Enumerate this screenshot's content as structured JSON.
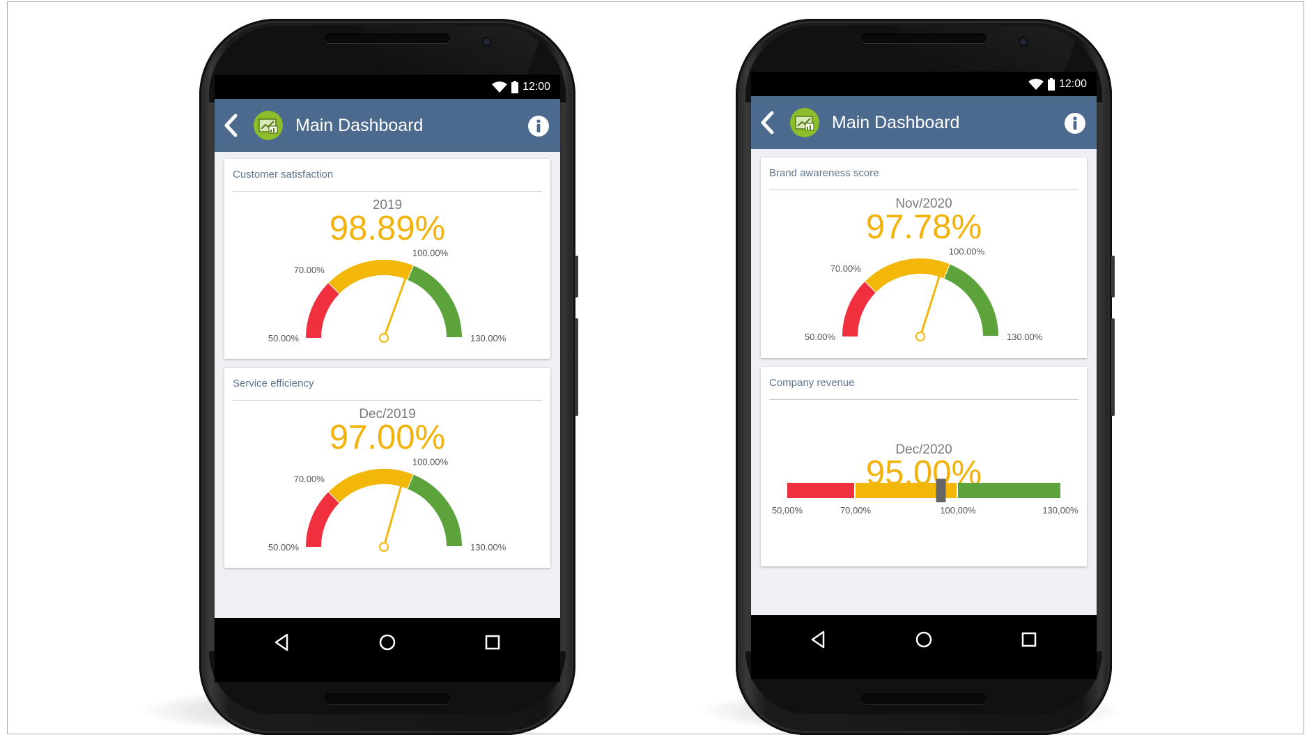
{
  "status_bar": {
    "time": "12:00"
  },
  "app_bar": {
    "title": "Main Dashboard"
  },
  "phones": [
    {
      "cards": [
        {
          "title": "Customer satisfaction",
          "period": "2019",
          "value": "98.89%",
          "widget": "gauge",
          "value_number": 98.89,
          "ticks": {
            "min": "50.00%",
            "low": "70.00%",
            "high": "100.00%",
            "max": "130.00%"
          }
        },
        {
          "title": "Service efficiency",
          "period": "Dec/2019",
          "value": "97.00%",
          "widget": "gauge",
          "value_number": 97.0,
          "ticks": {
            "min": "50.00%",
            "low": "70.00%",
            "high": "100.00%",
            "max": "130.00%"
          }
        }
      ]
    },
    {
      "cards": [
        {
          "title": "Brand awareness score",
          "period": "Nov/2020",
          "value": "97.78%",
          "widget": "gauge",
          "value_number": 97.78,
          "ticks": {
            "min": "50.00%",
            "low": "70.00%",
            "high": "100.00%",
            "max": "130.00%"
          }
        },
        {
          "title": "Company revenue",
          "period": "Dec/2020",
          "value": "95.00%",
          "widget": "bullet",
          "value_number": 95.0,
          "ticks": {
            "min": "50,00%",
            "low": "70,00%",
            "high": "100,00%",
            "max": "130,00%"
          }
        }
      ]
    }
  ],
  "scale": {
    "min": 50,
    "low": 70,
    "high": 100,
    "max": 130
  },
  "colors": {
    "red": "#f0303e",
    "yellow": "#f3b70a",
    "green": "#5ca33c",
    "needle": "#f3b70a",
    "app_bar": "#4b6a8e",
    "marker": "#666666"
  },
  "icons": {
    "back": "chevron-left-icon",
    "logo": "dashboard-app-logo",
    "info": "info-icon",
    "wifi": "wifi-icon",
    "battery": "battery-icon",
    "nav_back": "nav-back-icon",
    "nav_home": "nav-home-icon",
    "nav_recents": "nav-recents-icon"
  }
}
